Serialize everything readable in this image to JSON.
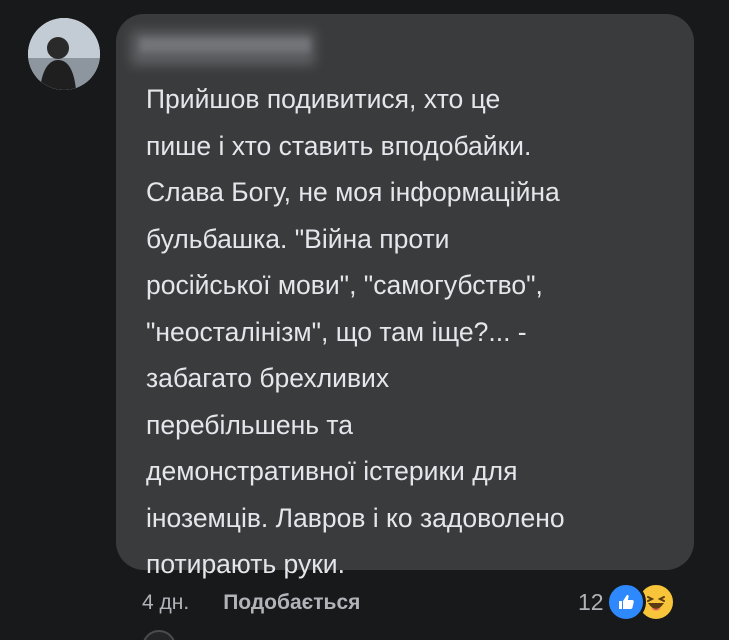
{
  "comment": {
    "author": "",
    "text": "Прийшов подивитися, хто це\nпише і хто ставить вподобайки.\nСлава Богу, не моя інформаційна\nбульбашка. \"Війна проти\nросійської мови\", \"самогубство\",\n\"неосталінізм\", що там іще?... -\nзабагато брехливих\nперебільшень та\nдемонстративної істерики для\nіноземців. Лавров і ко задоволено\nпотирають руки."
  },
  "actions": {
    "time": "4 дн.",
    "like": "Подобається"
  },
  "reactions": {
    "count": "12",
    "icons": [
      "like-icon",
      "haha-icon"
    ]
  },
  "colors": {
    "background": "#18191a",
    "bubble": "#3a3b3c",
    "text": "#e4e6eb",
    "secondary_text": "#b0b3b8",
    "like_blue": "#2e89ff",
    "haha_yellow": "#f7c43a"
  }
}
